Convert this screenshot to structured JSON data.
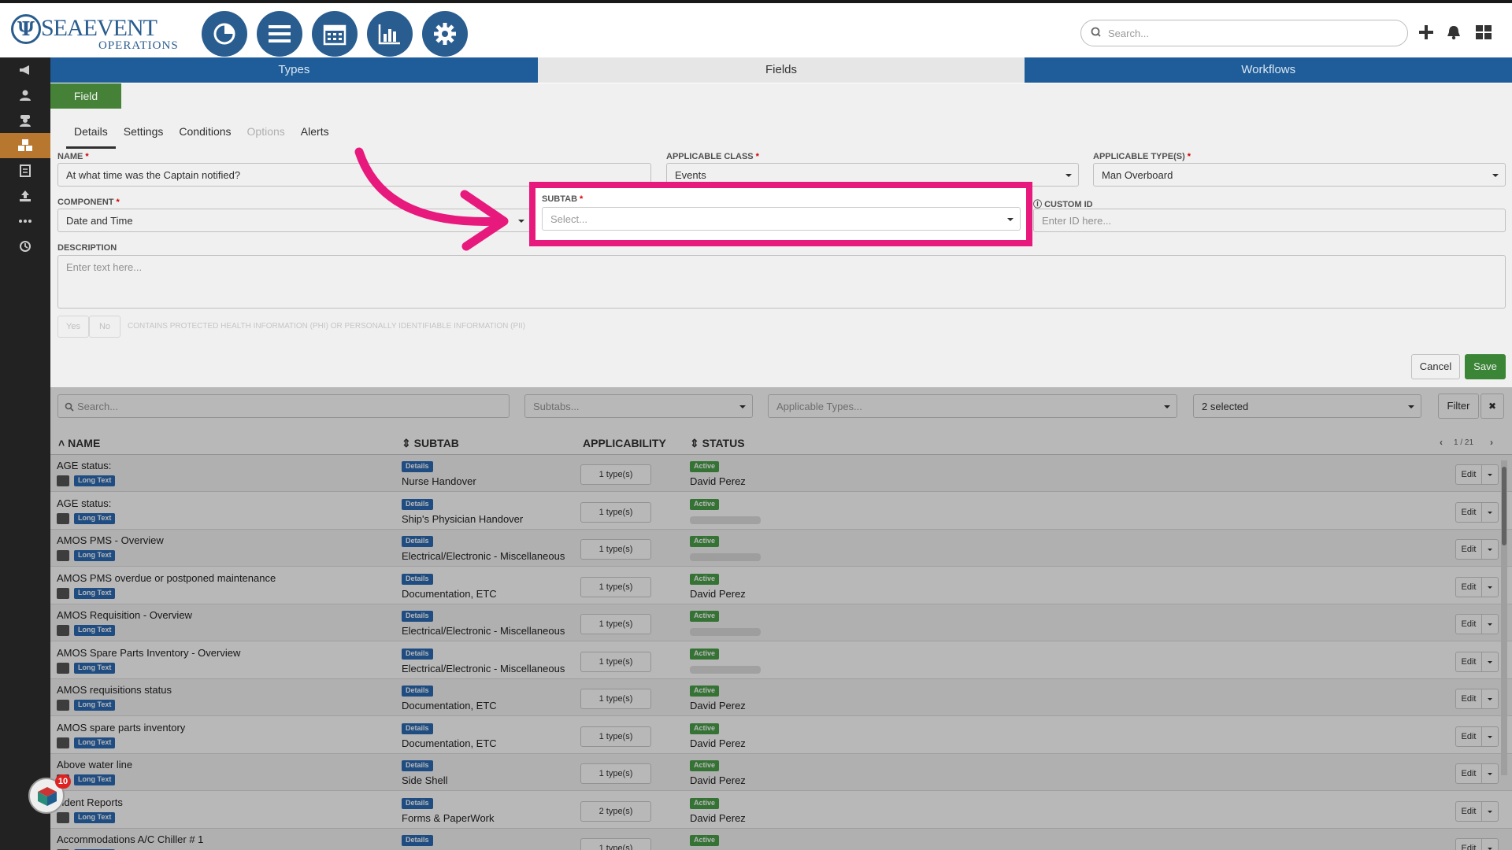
{
  "app": {
    "logo_name": "SEAEVENT",
    "logo_sub": "OPERATIONS",
    "search_placeholder": "Search..."
  },
  "tabs": [
    "Types",
    "Fields",
    "Workflows"
  ],
  "field_tab": "Field",
  "subtabs": [
    "Details",
    "Settings",
    "Conditions",
    "Options",
    "Alerts"
  ],
  "form": {
    "name_label": "NAME",
    "name_value": "At what time was the Captain notified?",
    "class_label": "APPLICABLE CLASS",
    "class_value": "Events",
    "types_label": "APPLICABLE TYPE(S)",
    "types_value": "Man Overboard",
    "component_label": "COMPONENT",
    "component_value": "Date and Time",
    "subtab_label": "SUBTAB",
    "subtab_placeholder": "Select...",
    "customid_label": "CUSTOM ID",
    "customid_placeholder": "Enter ID here...",
    "desc_label": "DESCRIPTION",
    "desc_placeholder": "Enter text here...",
    "phi_text": "CONTAINS PROTECTED HEALTH INFORMATION (PHI) OR PERSONALLY IDENTIFIABLE INFORMATION (PII)",
    "yes": "Yes",
    "no": "No",
    "cancel": "Cancel",
    "save": "Save"
  },
  "filters": {
    "search": "Search...",
    "subtabs": "Subtabs...",
    "types": "Applicable Types...",
    "status": "2 selected",
    "filter": "Filter",
    "clear": "✖"
  },
  "table": {
    "headers": [
      "NAME",
      "SUBTAB",
      "APPLICABILITY",
      "STATUS"
    ],
    "pager": "1 / 21",
    "rows": [
      {
        "name": "AGE status:",
        "badge": "Long Text",
        "tag": "Details",
        "subtab": "Nurse Handover",
        "app": "1 type(s)",
        "status": "Active",
        "person": "David Perez"
      },
      {
        "name": "AGE status:",
        "badge": "Long Text",
        "tag": "Details",
        "subtab": "Ship's Physician Handover",
        "app": "1 type(s)",
        "status": "Active",
        "person": ""
      },
      {
        "name": "AMOS PMS - Overview",
        "badge": "Long Text",
        "tag": "Details",
        "subtab": "Electrical/Electronic - Miscellaneous",
        "app": "1 type(s)",
        "status": "Active",
        "person": ""
      },
      {
        "name": "AMOS PMS overdue or postponed maintenance",
        "badge": "Long Text",
        "tag": "Details",
        "subtab": "Documentation, ETC",
        "app": "1 type(s)",
        "status": "Active",
        "person": "David Perez"
      },
      {
        "name": "AMOS Requisition - Overview",
        "badge": "Long Text",
        "tag": "Details",
        "subtab": "Electrical/Electronic - Miscellaneous",
        "app": "1 type(s)",
        "status": "Active",
        "person": ""
      },
      {
        "name": "AMOS Spare Parts Inventory - Overview",
        "badge": "Long Text",
        "tag": "Details",
        "subtab": "Electrical/Electronic - Miscellaneous",
        "app": "1 type(s)",
        "status": "Active",
        "person": ""
      },
      {
        "name": "AMOS requisitions status",
        "badge": "Long Text",
        "tag": "Details",
        "subtab": "Documentation, ETC",
        "app": "1 type(s)",
        "status": "Active",
        "person": "David Perez"
      },
      {
        "name": "AMOS spare parts inventory",
        "badge": "Long Text",
        "tag": "Details",
        "subtab": "Documentation, ETC",
        "app": "1 type(s)",
        "status": "Active",
        "person": "David Perez"
      },
      {
        "name": "Above water line",
        "badge": "Long Text",
        "tag": "Details",
        "subtab": "Side Shell",
        "app": "1 type(s)",
        "status": "Active",
        "person": "David Perez"
      },
      {
        "name": "cident Reports",
        "badge": "Long Text",
        "tag": "Details",
        "subtab": "Forms & PaperWork",
        "app": "2 type(s)",
        "status": "Active",
        "person": "David Perez"
      },
      {
        "name": "Accommodations A/C Chiller # 1",
        "badge": "Long Text",
        "tag": "Details",
        "subtab": "",
        "app": "1 type(s)",
        "status": "Active",
        "person": ""
      }
    ],
    "edit": "Edit"
  },
  "chat_badge": "10",
  "colors": {
    "brand": "#2a5d8f",
    "tab_active_bg": "#e6e6e6",
    "highlight": "#e8197d",
    "save": "#3e8e3a"
  }
}
